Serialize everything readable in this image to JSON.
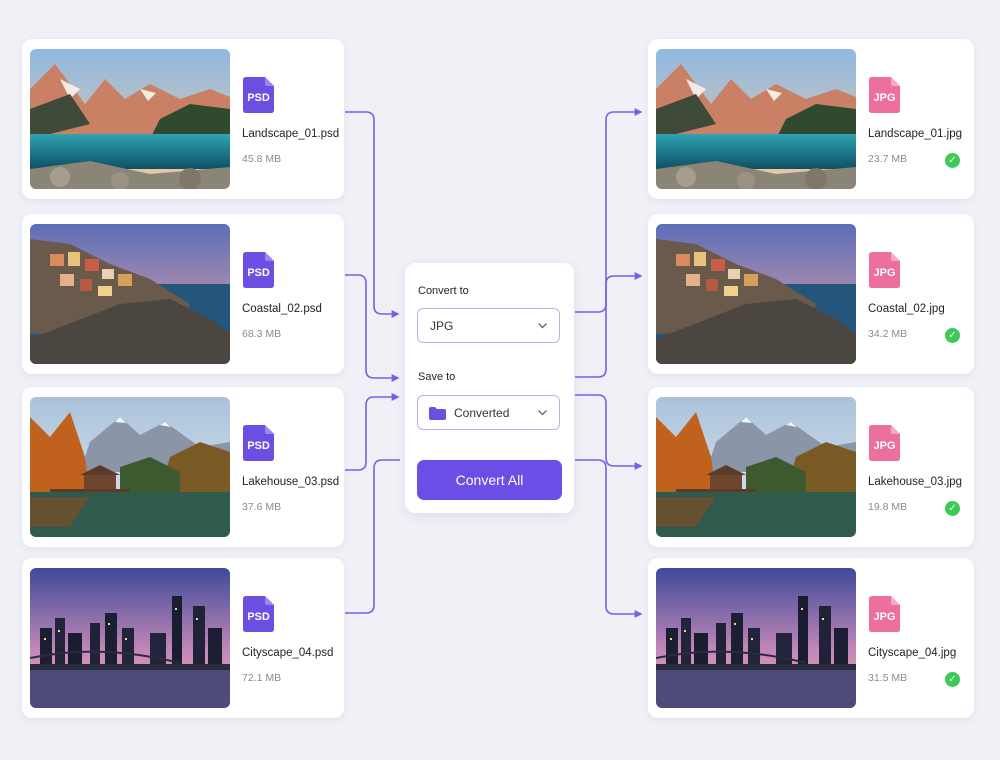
{
  "panel": {
    "convert_to_label": "Convert to",
    "format_value": "JPG",
    "save_to_label": "Save to",
    "folder_value": "Converted",
    "convert_button": "Convert All"
  },
  "source_files": [
    {
      "badge": "PSD",
      "name": "Landscape_01.psd",
      "size": "45.8 MB"
    },
    {
      "badge": "PSD",
      "name": "Coastal_02.psd",
      "size": "68.3 MB"
    },
    {
      "badge": "PSD",
      "name": "Lakehouse_03.psd",
      "size": "37.6 MB"
    },
    {
      "badge": "PSD",
      "name": "Cityscape_04.psd",
      "size": "72.1 MB"
    }
  ],
  "output_files": [
    {
      "badge": "JPG",
      "name": "Landscape_01.jpg",
      "size": "23.7 MB",
      "status": "check-icon"
    },
    {
      "badge": "JPG",
      "name": "Coastal_02.jpg",
      "size": "34.2 MB",
      "status": "check-icon"
    },
    {
      "badge": "JPG",
      "name": "Lakehouse_03.jpg",
      "size": "19.8 MB",
      "status": "check-icon"
    },
    {
      "badge": "JPG",
      "name": "Cityscape_04.jpg",
      "size": "31.5 MB",
      "status": "check-icon"
    }
  ],
  "colors": {
    "accent": "#6b4ee6",
    "psd_icon": "#6a4fe0",
    "jpg_icon": "#ec6f9d",
    "success": "#3ec957",
    "connector": "#7a5ee8",
    "background": "#f0f0f7"
  }
}
